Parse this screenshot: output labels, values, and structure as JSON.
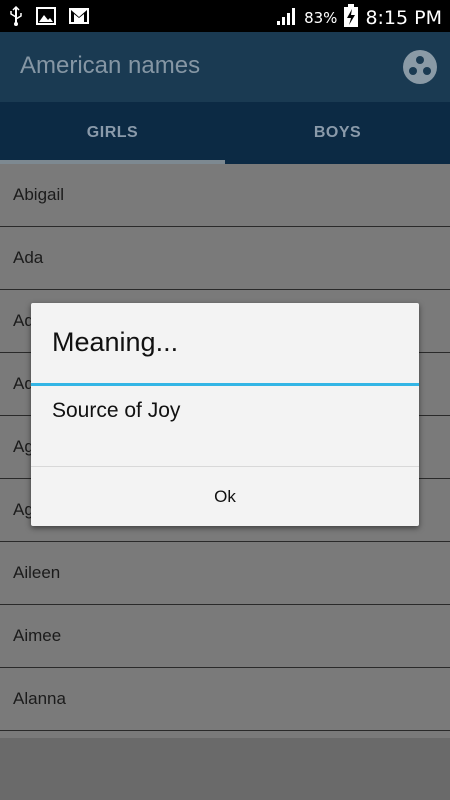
{
  "status_bar": {
    "battery": "83%",
    "time": "8:15 PM",
    "icons": [
      "usb-icon",
      "image-icon",
      "gmail-icon",
      "signal-icon",
      "battery-charging-icon"
    ]
  },
  "app_bar": {
    "title": "American names",
    "menu_icon": "overflow-dots-icon",
    "colors": {
      "bar": "#1a3a52",
      "tabs": "#0c2a44"
    }
  },
  "tabs": [
    {
      "label": "GIRLS",
      "selected": true
    },
    {
      "label": "BOYS",
      "selected": false
    }
  ],
  "list": {
    "items": [
      "Abigail",
      "Ada",
      "Ad",
      "Ad",
      "Ag",
      "Ag",
      "Aileen",
      "Aimee",
      "Alanna"
    ]
  },
  "dialog": {
    "title": "Meaning...",
    "message": "Source of Joy",
    "ok_label": "Ok",
    "accent": "#33b5e5"
  }
}
